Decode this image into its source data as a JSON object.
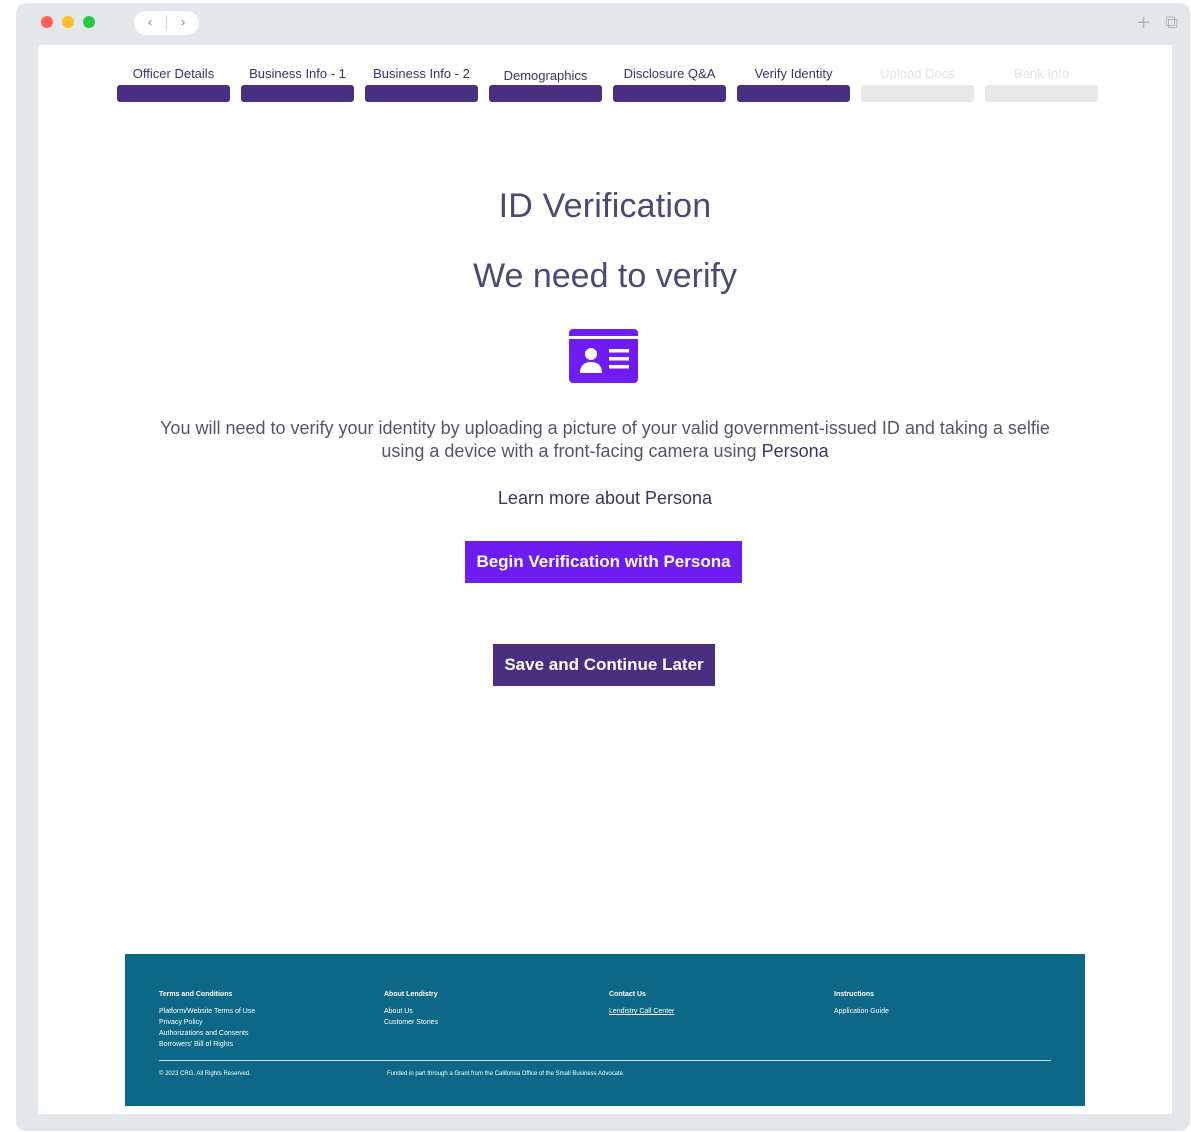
{
  "browser": {
    "back_icon": "‹",
    "forward_icon": "›",
    "new_tab_icon": "+",
    "window_icon": "⧉"
  },
  "steps": [
    {
      "label": "Officer Details",
      "active": true
    },
    {
      "label": "Business Info - 1",
      "active": true
    },
    {
      "label": "Business Info - 2",
      "active": true
    },
    {
      "label": "Demographics",
      "active": true
    },
    {
      "label": "Disclosure Q&A",
      "active": true
    },
    {
      "label": "Verify Identity",
      "active": true
    },
    {
      "label": "Upload Docs",
      "active": false
    },
    {
      "label": "Bank Info",
      "active": false
    }
  ],
  "main": {
    "title": "ID Verification",
    "subtitle": "We need to verify",
    "description": "You will need to verify your identity by uploading a picture of your valid government-issued ID and taking a selfie using a device with a front-facing camera using ",
    "persona_link": "Persona",
    "learn_more": "Learn more about Persona",
    "begin_button": "Begin Verification with Persona",
    "save_button": "Save and Continue Later"
  },
  "colors": {
    "primary_purple": "#4a2e7f",
    "accent_violet": "#6e1cf2",
    "footer_teal": "#0d6787"
  },
  "footer": {
    "columns": [
      {
        "title": "Terms and Conditions",
        "items": [
          "Platform/Website Terms of Use",
          "Privacy Policy",
          "Authorizations and Consents",
          "Borrowers' Bill of Rights"
        ]
      },
      {
        "title": "About Lendistry",
        "items": [
          "About Us",
          "Customer Stories"
        ]
      },
      {
        "title": "Contact Us",
        "items": [
          "Lendistry Call Center"
        ]
      },
      {
        "title": "Instructions",
        "items": [
          "Application Guide"
        ]
      }
    ],
    "copyright": "© 2023 CRG. All Rights Reserved.",
    "funding": "Funded in part through a Grant from the California Office of the Small Business Advocate."
  }
}
